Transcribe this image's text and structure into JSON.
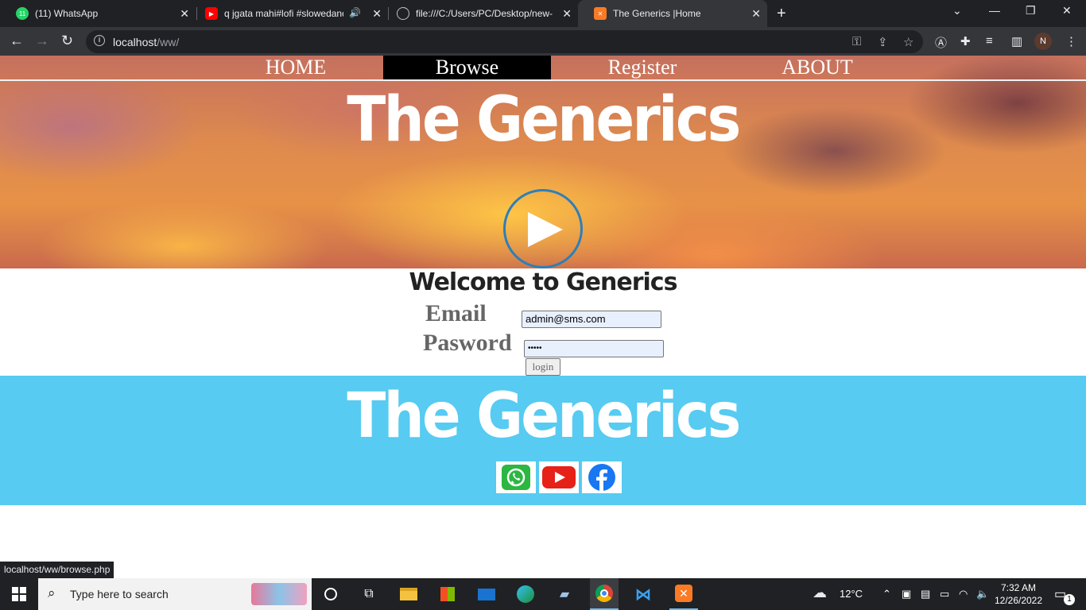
{
  "browser": {
    "tabs": [
      {
        "title": "(11) WhatsApp",
        "badge": "11",
        "icon": "whatsapp-icon"
      },
      {
        "title": "q jgata mahi#lofi #slowedand",
        "icon": "youtube-icon",
        "audio": "speaker-icon"
      },
      {
        "title": "file:///C:/Users/PC/Desktop/new-",
        "icon": "globe-icon"
      },
      {
        "title": "The Generics |Home",
        "icon": "xampp-icon",
        "active": true
      }
    ],
    "url_host": "localhost",
    "url_path": "/ww/",
    "profile_initial": "N"
  },
  "site": {
    "nav": [
      "HOME",
      "Browse",
      "Register",
      "ABOUT"
    ],
    "active_nav": "Browse",
    "brand": "The Generics",
    "welcome": "Welcome to Generics",
    "email_label": "Email",
    "email_value": "admin@sms.com",
    "password_label": "Pasword",
    "password_value": "•••••",
    "login_label": "login",
    "footer_brand": "The Generics",
    "social": [
      "whatsapp-icon",
      "youtube-icon",
      "facebook-icon"
    ]
  },
  "status_url": "localhost/ww/browse.php",
  "taskbar": {
    "search_placeholder": "Type here to search",
    "weather": "12°C",
    "time": "7:32 AM",
    "date": "12/26/2022",
    "notifications": "1"
  }
}
